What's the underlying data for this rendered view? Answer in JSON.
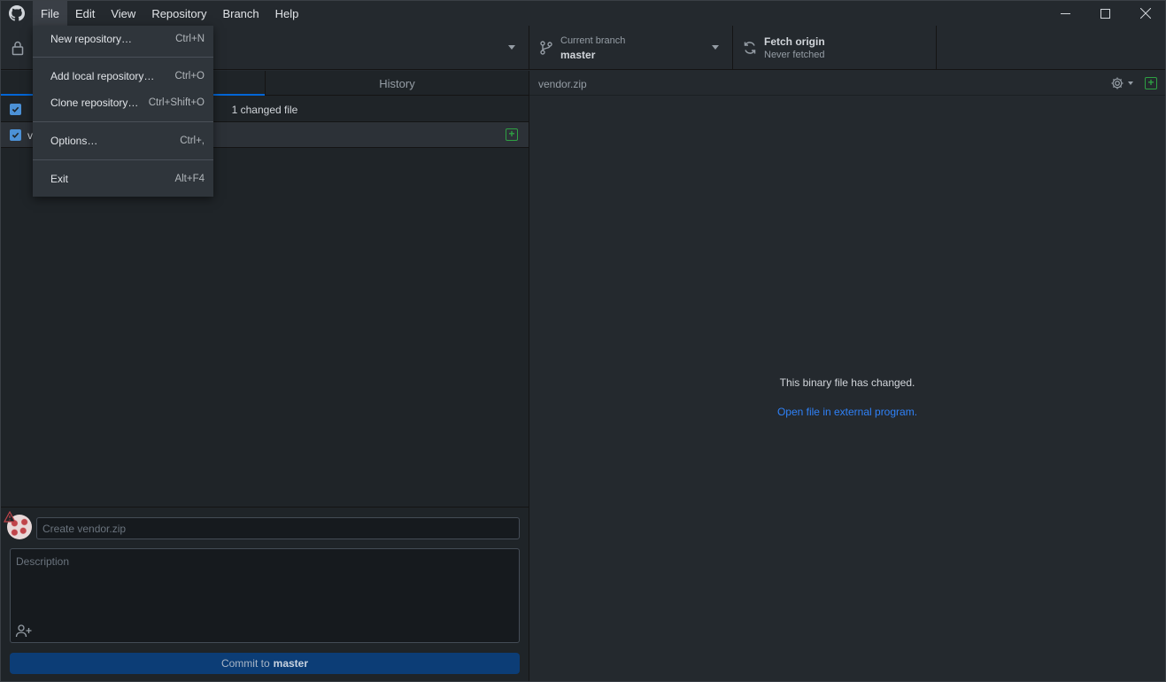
{
  "menubar": {
    "items": [
      "File",
      "Edit",
      "View",
      "Repository",
      "Branch",
      "Help"
    ]
  },
  "toolbar": {
    "branch_label": "Current branch",
    "branch_name": "master",
    "fetch_title": "Fetch origin",
    "fetch_status": "Never fetched"
  },
  "tabs": {
    "changes": "",
    "history": "History"
  },
  "changes": {
    "count_label": "1 changed file",
    "file_name": "v"
  },
  "commit": {
    "summary_placeholder": "Create vendor.zip",
    "description_placeholder": "Description",
    "button_prefix": "Commit to",
    "button_branch": "master"
  },
  "diff": {
    "path": "vendor.zip",
    "binary_message": "This binary file has changed.",
    "open_external": "Open file in external program."
  },
  "file_menu": {
    "items": [
      {
        "label": "New repository…",
        "accelerator": "Ctrl+N"
      },
      {
        "label": "Add local repository…",
        "accelerator": "Ctrl+O"
      },
      {
        "label": "Clone repository…",
        "accelerator": "Ctrl+Shift+O"
      },
      {
        "label": "Options…",
        "accelerator": "Ctrl+,"
      },
      {
        "label": "Exit",
        "accelerator": "Alt+F4"
      }
    ]
  },
  "colors": {
    "accent": "#0366d6",
    "added": "#2ea043",
    "link": "#2f81f7",
    "commit_button": "#0c3d76"
  },
  "icons": [
    "github-logo-icon",
    "lock-icon",
    "branch-icon",
    "sync-icon",
    "gear-icon",
    "add-file-icon",
    "coauthor-icon",
    "warning-icon"
  ]
}
